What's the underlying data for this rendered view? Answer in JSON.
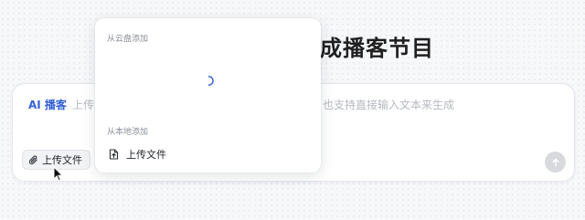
{
  "page": {
    "title": "一键生成播客节目"
  },
  "composer": {
    "mode_tag": "AI 播客",
    "placeholder_left": "上传",
    "placeholder_right": "，也支持直接输入文本来生成",
    "upload_button_label": "上传文件",
    "send_button_icon": "arrow-up-icon"
  },
  "dropdown": {
    "cloud_section_label": "从云盘添加",
    "cloud_loading_icon": "loading-spinner-icon",
    "local_section_label": "从本地添加",
    "local_items": [
      {
        "label": "上传文件",
        "icon": "file-upload-icon"
      }
    ]
  },
  "colors": {
    "accent": "#3561d4",
    "placeholder": "#b5b9c0",
    "send_button_disabled": "#d7d9dd"
  }
}
